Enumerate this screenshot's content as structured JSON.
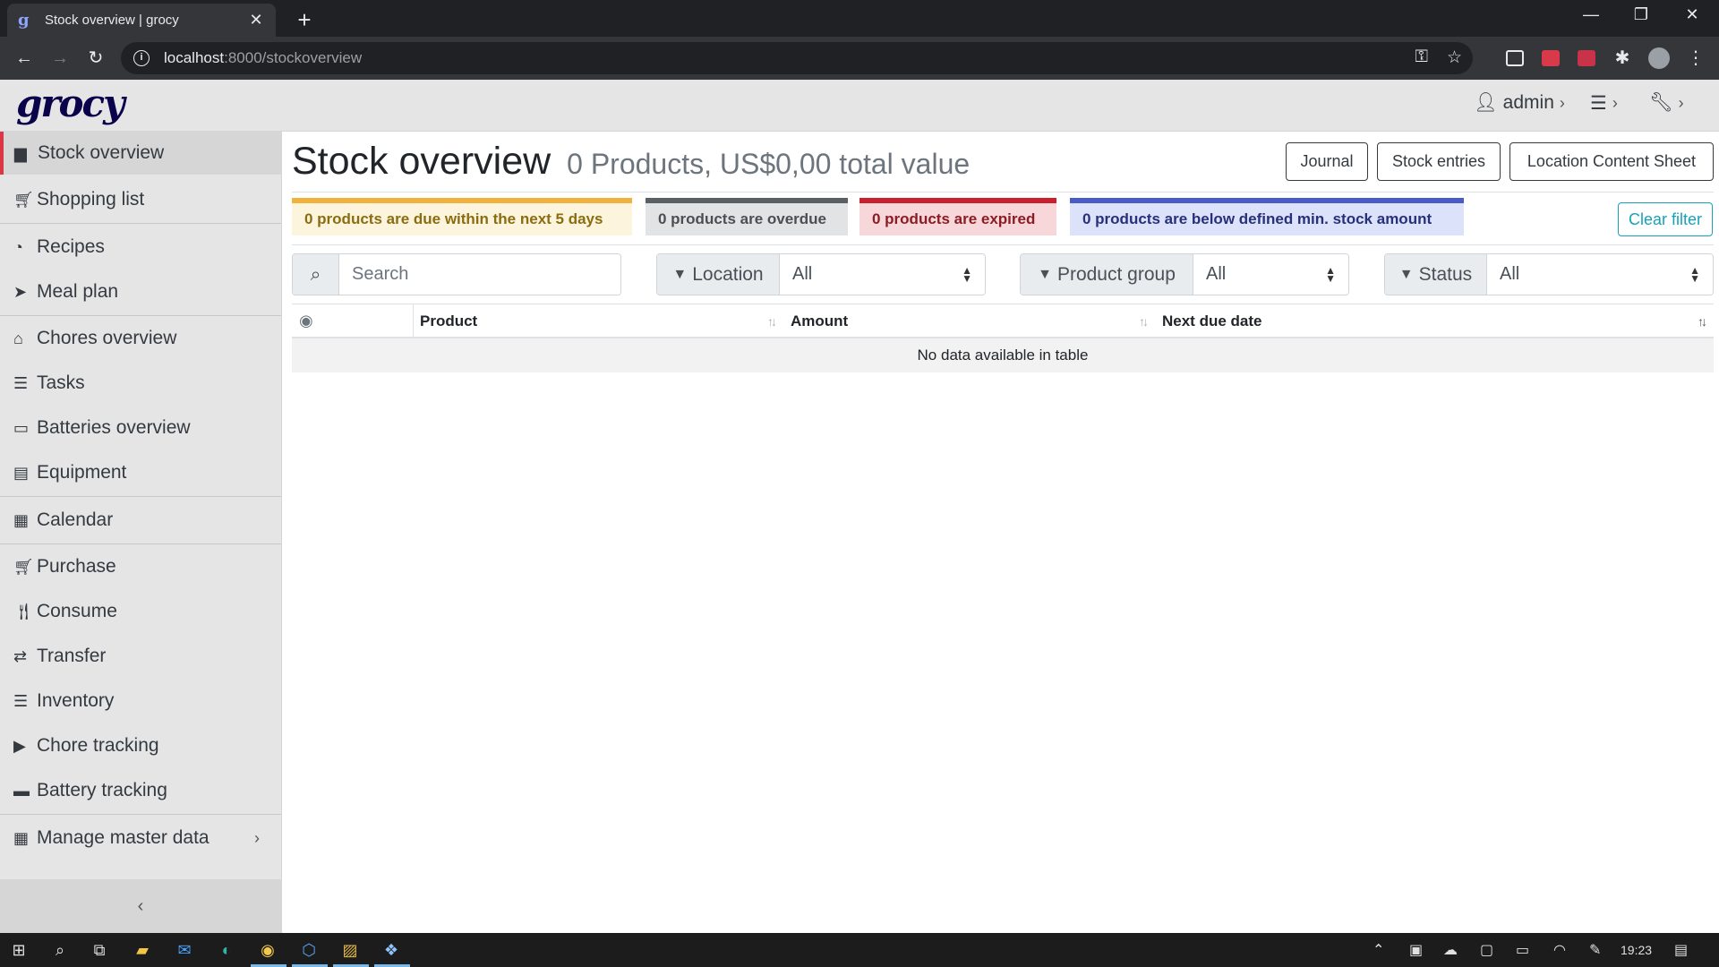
{
  "browser": {
    "tab_title": "Stock overview | grocy",
    "tab_favicon": "g",
    "url_host": "localhost",
    "url_path": ":8000/stockoverview"
  },
  "app": {
    "logo": "grocy",
    "user": "admin"
  },
  "sidebar": {
    "items": [
      {
        "label": "Stock overview",
        "icon": "box-icon"
      },
      {
        "label": "Shopping list",
        "icon": "cart-icon"
      },
      {
        "label": "Recipes",
        "icon": "recipes-icon"
      },
      {
        "label": "Meal plan",
        "icon": "paper-plane-icon"
      },
      {
        "label": "Chores overview",
        "icon": "home-icon"
      },
      {
        "label": "Tasks",
        "icon": "tasks-icon"
      },
      {
        "label": "Batteries overview",
        "icon": "battery-icon"
      },
      {
        "label": "Equipment",
        "icon": "toolbox-icon"
      },
      {
        "label": "Calendar",
        "icon": "calendar-icon"
      },
      {
        "label": "Purchase",
        "icon": "cart-plus-icon"
      },
      {
        "label": "Consume",
        "icon": "utensils-icon"
      },
      {
        "label": "Transfer",
        "icon": "exchange-icon"
      },
      {
        "label": "Inventory",
        "icon": "list-icon"
      },
      {
        "label": "Chore tracking",
        "icon": "play-icon"
      },
      {
        "label": "Battery tracking",
        "icon": "car-battery-icon"
      },
      {
        "label": "Manage master data",
        "icon": "table-icon"
      }
    ]
  },
  "main": {
    "title": "Stock overview",
    "subtitle": "0 Products, US$0,00 total value",
    "buttons": {
      "journal": "Journal",
      "stock_entries": "Stock entries",
      "location_sheet": "Location Content Sheet",
      "clear_filter": "Clear filter"
    },
    "status": {
      "due": "0 products are due within the next 5 days",
      "overdue": "0 products are overdue",
      "expired": "0 products are expired",
      "below_min": "0 products are below defined min. stock amount"
    },
    "filters": {
      "search_placeholder": "Search",
      "location_label": "Location",
      "location_value": "All",
      "product_group_label": "Product group",
      "product_group_value": "All",
      "status_label": "Status",
      "status_value": "All"
    },
    "table": {
      "columns": [
        "Product",
        "Amount",
        "Next due date"
      ],
      "empty_message": "No data available in table"
    }
  },
  "taskbar": {
    "clock": "19:23"
  }
}
